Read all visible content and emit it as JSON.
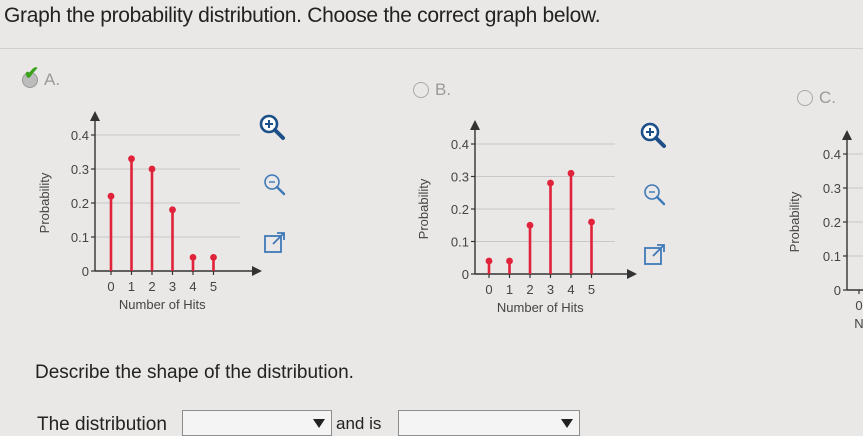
{
  "question": "Graph the probability distribution. Choose the correct graph below.",
  "options": [
    {
      "label": "A.",
      "selected": true
    },
    {
      "label": "B.",
      "selected": false
    },
    {
      "label": "C.",
      "selected": false
    }
  ],
  "chart_data": [
    {
      "type": "bar",
      "categories": [
        "0",
        "1",
        "2",
        "3",
        "4",
        "5"
      ],
      "values": [
        0.22,
        0.33,
        0.3,
        0.18,
        0.04,
        0.04
      ],
      "xlabel": "Number of Hits",
      "ylabel": "Probability",
      "yticks": [
        "0",
        "0.1",
        "0.2",
        "0.3",
        "0.4"
      ],
      "ylim": [
        0,
        0.4
      ]
    },
    {
      "type": "bar",
      "categories": [
        "0",
        "1",
        "2",
        "3",
        "4",
        "5"
      ],
      "values": [
        0.04,
        0.04,
        0.15,
        0.28,
        0.31,
        0.16
      ],
      "xlabel": "Number of Hits",
      "ylabel": "Probability",
      "yticks": [
        "0",
        "0.1",
        "0.2",
        "0.3",
        "0.4"
      ],
      "ylim": [
        0,
        0.4
      ]
    },
    {
      "type": "bar",
      "categories": [
        "0"
      ],
      "values": [],
      "xlabel": "N",
      "ylabel": "Probability",
      "yticks": [
        "0",
        "0.1",
        "0.2",
        "0.3",
        "0.4"
      ],
      "ylim": [
        0,
        0.4
      ]
    }
  ],
  "icons": [
    "zoom-in-icon",
    "zoom-out-icon",
    "open-new-window-icon"
  ],
  "colors": {
    "bar": "#e0223a",
    "grid": "#c8c8c8",
    "axis": "#333333"
  },
  "describe": "Describe the shape of the distribution.",
  "answer": {
    "prefix": "The distribution",
    "middle": "and is"
  }
}
